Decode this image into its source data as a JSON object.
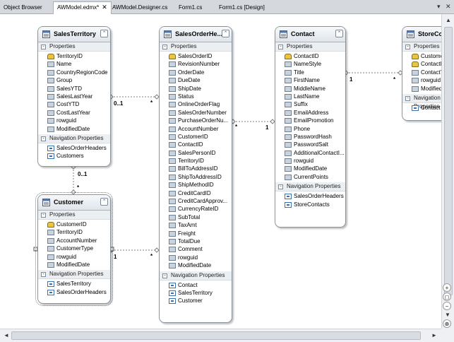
{
  "tabs": [
    {
      "label": "Object Browser",
      "active": false
    },
    {
      "label": "AWModel.edmx*",
      "active": true
    },
    {
      "label": "AWModel.Designer.cs",
      "active": false
    },
    {
      "label": "Form1.cs",
      "active": false
    },
    {
      "label": "Form1.cs [Design]",
      "active": false
    }
  ],
  "tab_close_glyph": "✕",
  "tab_controls": {
    "dropdown": "▾",
    "close": "✕"
  },
  "sections": {
    "properties": "Properties",
    "navigation": "Navigation Properties"
  },
  "entities": {
    "salesterritory": {
      "title": "SalesTerritory",
      "properties": [
        "TerritoryID",
        "Name",
        "CountryRegionCode",
        "Group",
        "SalesYTD",
        "SalesLastYear",
        "CostYTD",
        "CostLastYear",
        "rowguid",
        "ModifiedDate"
      ],
      "keys": [
        "TerritoryID"
      ],
      "navigation": [
        "SalesOrderHeaders",
        "Customers"
      ]
    },
    "customer": {
      "title": "Customer",
      "properties": [
        "CustomerID",
        "TerritoryID",
        "AccountNumber",
        "CustomerType",
        "rowguid",
        "ModifiedDate"
      ],
      "keys": [
        "CustomerID"
      ],
      "navigation": [
        "SalesTerritory",
        "SalesOrderHeaders"
      ]
    },
    "salesorderheader": {
      "title": "SalesOrderHe...",
      "properties": [
        "SalesOrderID",
        "RevisionNumber",
        "OrderDate",
        "DueDate",
        "ShipDate",
        "Status",
        "OnlineOrderFlag",
        "SalesOrderNumber",
        "PurchaseOrderNu...",
        "AccountNumber",
        "CustomerID",
        "ContactID",
        "SalesPersonID",
        "TerritoryID",
        "BillToAddressID",
        "ShipToAddressID",
        "ShipMethodID",
        "CreditCardID",
        "CreditCardApprov...",
        "CurrencyRateID",
        "SubTotal",
        "TaxAmt",
        "Freight",
        "TotalDue",
        "Comment",
        "rowguid",
        "ModifiedDate"
      ],
      "keys": [
        "SalesOrderID"
      ],
      "navigation": [
        "Contact",
        "SalesTerritory",
        "Customer"
      ]
    },
    "contact": {
      "title": "Contact",
      "properties": [
        "ContactID",
        "NameStyle",
        "Title",
        "FirstName",
        "MiddleName",
        "LastName",
        "Suffix",
        "EmailAddress",
        "EmailPromotion",
        "Phone",
        "PasswordHash",
        "PasswordSalt",
        "AdditionalContactI...",
        "rowguid",
        "ModifiedDate",
        "CurrentPoints"
      ],
      "keys": [
        "ContactID"
      ],
      "navigation": [
        "SalesOrderHeaders",
        "StoreContacts"
      ]
    },
    "storecontact": {
      "title": "StoreCon",
      "properties": [
        "Customer",
        "ContactID",
        "ContactT",
        "rowguid",
        "ModifiedD"
      ],
      "keys": [
        "Customer",
        "ContactID"
      ],
      "navigation": [
        "Contact"
      ]
    }
  },
  "multiplicities": {
    "st_soh_left": "0..1",
    "st_soh_right": "*",
    "st_cust_top": "0..1",
    "st_cust_bottom": "*",
    "cust_soh_left": "1",
    "cust_soh_right": "*",
    "soh_contact_left": "*",
    "soh_contact_right": "1",
    "contact_store_left": "1",
    "contact_store_right": "*"
  },
  "scroll": {
    "up": "▲",
    "down": "▼",
    "left": "◄",
    "right": "►"
  },
  "zoom": {
    "in": "+",
    "reset": "◻",
    "out": "−",
    "fit": "⊕"
  }
}
